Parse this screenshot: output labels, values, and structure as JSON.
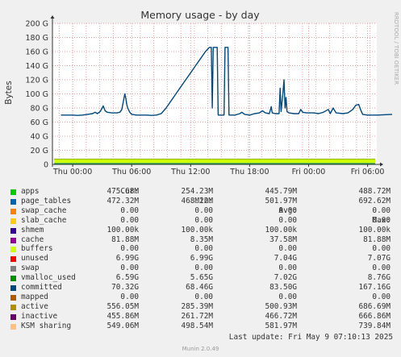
{
  "chart_data": {
    "type": "area",
    "title": "Memory usage - by day",
    "ylabel": "Bytes",
    "side_label": "RRDTOOL / TOBI OETIKER",
    "ylim": [
      0,
      200
    ],
    "yticks": [
      "0",
      "20 G",
      "40 G",
      "60 G",
      "80 G",
      "100 G",
      "120 G",
      "140 G",
      "160 G",
      "180 G",
      "200 G"
    ],
    "xlim": [
      -1.5,
      22.5
    ],
    "xticks": [
      {
        "label": "Thu 00:00",
        "hour": 0
      },
      {
        "label": "Thu 06:00",
        "hour": 6
      },
      {
        "label": "Thu 12:00",
        "hour": 12
      },
      {
        "label": "Thu 18:00",
        "hour": 18
      },
      {
        "label": "Fri 00:00",
        "hour": 24
      },
      {
        "label": "Fri 06:00",
        "hour": 30
      }
    ],
    "stack_colors": [
      "#00cc00",
      "#0066b3",
      "#ff8000",
      "#ffcc00",
      "#330099",
      "#990099",
      "#ccff00",
      "#ff0000",
      "#808080",
      "#008f00",
      "#00487d",
      "#b35a00",
      "#b38f00",
      "#6b006b",
      "#8fb300"
    ],
    "series": [
      {
        "name": "unused",
        "values_G": [
          7.0,
          7.0
        ]
      },
      {
        "name": "committed",
        "color": "#00487d",
        "points": [
          [
            -1.2,
            70
          ],
          [
            0,
            70
          ],
          [
            0.5,
            69.5
          ],
          [
            1.0,
            70
          ],
          [
            1.5,
            71
          ],
          [
            2.0,
            72
          ],
          [
            2.3,
            74
          ],
          [
            2.5,
            72
          ],
          [
            2.8,
            75
          ],
          [
            3.0,
            80
          ],
          [
            3.1,
            83
          ],
          [
            3.3,
            76
          ],
          [
            3.5,
            74
          ],
          [
            4.0,
            73
          ],
          [
            4.5,
            73
          ],
          [
            4.8,
            74
          ],
          [
            5.0,
            78
          ],
          [
            5.2,
            93
          ],
          [
            5.3,
            100
          ],
          [
            5.4,
            94
          ],
          [
            5.5,
            85
          ],
          [
            5.6,
            80
          ],
          [
            5.8,
            74
          ],
          [
            6.0,
            71
          ],
          [
            6.5,
            70
          ],
          [
            7.0,
            70
          ],
          [
            7.5,
            70
          ],
          [
            8.0,
            69.5
          ],
          [
            8.5,
            70
          ],
          [
            9.0,
            72
          ],
          [
            9.5,
            80
          ],
          [
            10.0,
            90
          ],
          [
            10.5,
            100
          ],
          [
            11.0,
            110
          ],
          [
            11.5,
            120
          ],
          [
            12.0,
            130
          ],
          [
            12.5,
            140
          ],
          [
            13.0,
            150
          ],
          [
            13.5,
            160
          ],
          [
            13.9,
            166
          ],
          [
            14.1,
            166
          ],
          [
            14.2,
            80
          ],
          [
            14.3,
            166
          ],
          [
            14.7,
            166
          ],
          [
            14.8,
            70
          ],
          [
            15.4,
            70
          ],
          [
            15.5,
            166
          ],
          [
            15.8,
            166
          ],
          [
            15.9,
            70
          ],
          [
            16.5,
            70
          ],
          [
            17.0,
            72
          ],
          [
            17.2,
            74
          ],
          [
            17.5,
            71
          ],
          [
            18.0,
            70
          ],
          [
            18.5,
            72
          ],
          [
            19.0,
            73
          ],
          [
            19.3,
            76
          ],
          [
            19.6,
            73
          ],
          [
            20.0,
            72
          ],
          [
            20.2,
            82
          ],
          [
            20.3,
            73
          ],
          [
            20.6,
            72
          ],
          [
            21.0,
            72
          ],
          [
            21.1,
            108
          ],
          [
            21.2,
            75
          ],
          [
            21.4,
            103
          ],
          [
            21.5,
            120
          ],
          [
            21.6,
            80
          ],
          [
            21.7,
            95
          ],
          [
            21.8,
            75
          ],
          [
            22.0,
            73
          ],
          [
            22.5,
            72
          ],
          [
            23.0,
            72
          ],
          [
            23.2,
            78
          ],
          [
            23.4,
            74
          ],
          [
            23.8,
            73
          ],
          [
            24.5,
            73
          ],
          [
            25.0,
            72
          ],
          [
            25.5,
            74
          ],
          [
            26.0,
            78
          ],
          [
            26.2,
            72
          ],
          [
            26.5,
            80
          ],
          [
            26.8,
            73
          ],
          [
            27.5,
            72
          ],
          [
            28.0,
            73
          ],
          [
            28.5,
            78
          ],
          [
            28.8,
            84
          ],
          [
            29.1,
            85
          ],
          [
            29.3,
            77
          ],
          [
            29.5,
            71
          ],
          [
            30.0,
            70
          ],
          [
            31.0,
            70
          ],
          [
            32.5,
            71
          ]
        ]
      }
    ],
    "legend_headers": [
      "Cur:",
      "Min:",
      "Avg:",
      "Max:"
    ],
    "legend": [
      {
        "name": "apps",
        "color": "#00cc00",
        "cur": "475.68M",
        "min": "254.23M",
        "avg": "445.79M",
        "max": "488.72M"
      },
      {
        "name": "page_tables",
        "color": "#0066b3",
        "cur": "472.32M",
        "min": "468.22M",
        "avg": "501.97M",
        "max": "692.62M"
      },
      {
        "name": "swap_cache",
        "color": "#ff8000",
        "cur": "0.00",
        "min": "0.00",
        "avg": "0.00",
        "max": "0.00"
      },
      {
        "name": "slab_cache",
        "color": "#ffcc00",
        "cur": "0.00",
        "min": "0.00",
        "avg": "0.00",
        "max": "0.00"
      },
      {
        "name": "shmem",
        "color": "#330099",
        "cur": "100.00k",
        "min": "100.00k",
        "avg": "100.00k",
        "max": "100.00k"
      },
      {
        "name": "cache",
        "color": "#990099",
        "cur": "81.88M",
        "min": "8.35M",
        "avg": "37.58M",
        "max": "81.88M"
      },
      {
        "name": "buffers",
        "color": "#ccff00",
        "cur": "0.00",
        "min": "0.00",
        "avg": "0.00",
        "max": "0.00"
      },
      {
        "name": "unused",
        "color": "#ff0000",
        "cur": "6.99G",
        "min": "6.99G",
        "avg": "7.04G",
        "max": "7.07G"
      },
      {
        "name": "swap",
        "color": "#808080",
        "cur": "0.00",
        "min": "0.00",
        "avg": "0.00",
        "max": "0.00"
      },
      {
        "name": "vmalloc_used",
        "color": "#008f00",
        "cur": "6.59G",
        "min": "5.65G",
        "avg": "7.02G",
        "max": "8.76G"
      },
      {
        "name": "committed",
        "color": "#00487d",
        "cur": "70.32G",
        "min": "68.46G",
        "avg": "83.50G",
        "max": "167.16G"
      },
      {
        "name": "mapped",
        "color": "#b35a00",
        "cur": "0.00",
        "min": "0.00",
        "avg": "0.00",
        "max": "0.00"
      },
      {
        "name": "active",
        "color": "#b38f00",
        "cur": "556.05M",
        "min": "285.39M",
        "avg": "500.93M",
        "max": "686.69M"
      },
      {
        "name": "inactive",
        "color": "#6b006b",
        "cur": "455.86M",
        "min": "261.72M",
        "avg": "466.72M",
        "max": "666.86M"
      },
      {
        "name": "KSM sharing",
        "color": "#ffc080",
        "cur": "549.06M",
        "min": "498.54M",
        "avg": "581.97M",
        "max": "739.84M"
      }
    ]
  },
  "last_update": "Last update:  Fri May  9 07:10:13 2025",
  "footer": "Munin 2.0.49"
}
